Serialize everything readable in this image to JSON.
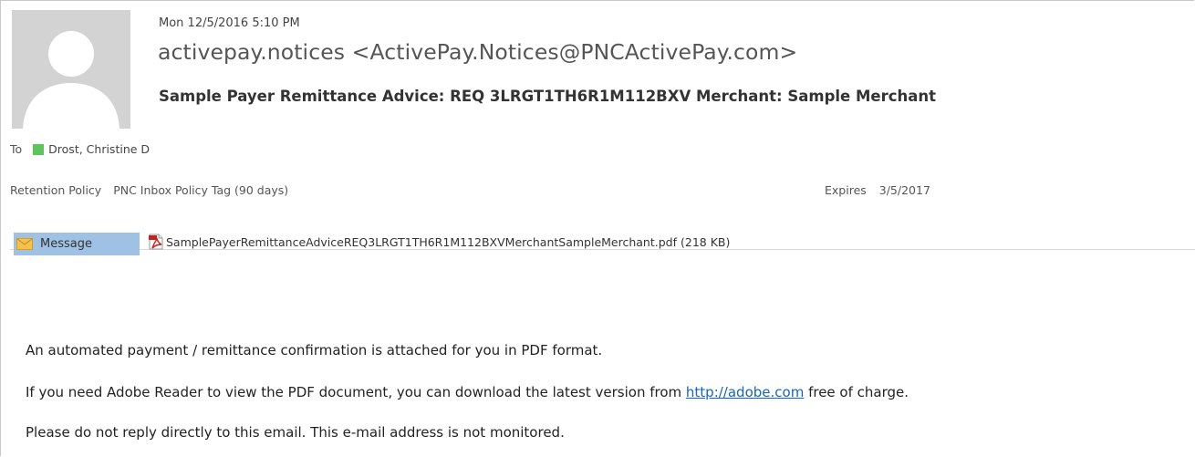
{
  "header": {
    "date": "Mon 12/5/2016 5:10 PM",
    "sender": "activepay.notices <ActivePay.Notices@PNCActivePay.com>",
    "subject": "Sample Payer Remittance Advice:  REQ 3LRGT1TH6R1M112BXV Merchant: Sample Merchant",
    "avatar_icon": "person-silhouette-icon"
  },
  "recipients": {
    "to_label": "To",
    "to_name": "Drost, Christine D",
    "presence_color": "#5cc65c"
  },
  "retention": {
    "label": "Retention Policy",
    "value": "PNC Inbox Policy Tag (90 days)",
    "expires_label": "Expires",
    "expires_date": "3/5/2017"
  },
  "attachments": {
    "message_tab_label": "Message",
    "message_icon": "envelope-icon",
    "file_icon": "pdf-icon",
    "file_name": "SamplePayerRemittanceAdviceREQ3LRGT1TH6R1M112BXVMerchantSampleMerchant.pdf",
    "file_size": "(218 KB)"
  },
  "body": {
    "line1": "An automated payment / remittance confirmation is attached for you in PDF format.",
    "line2_before": "If you need Adobe Reader to view the PDF document, you can download the latest version from ",
    "line2_link": "http://adobe.com",
    "line2_after": " free of charge.",
    "line3": "Please do not reply directly to this email. This e-mail address is not monitored."
  },
  "colors": {
    "message_tab_bg": "#9fc2e4",
    "link": "#1565c0",
    "avatar_bg": "#d3d3d3"
  }
}
